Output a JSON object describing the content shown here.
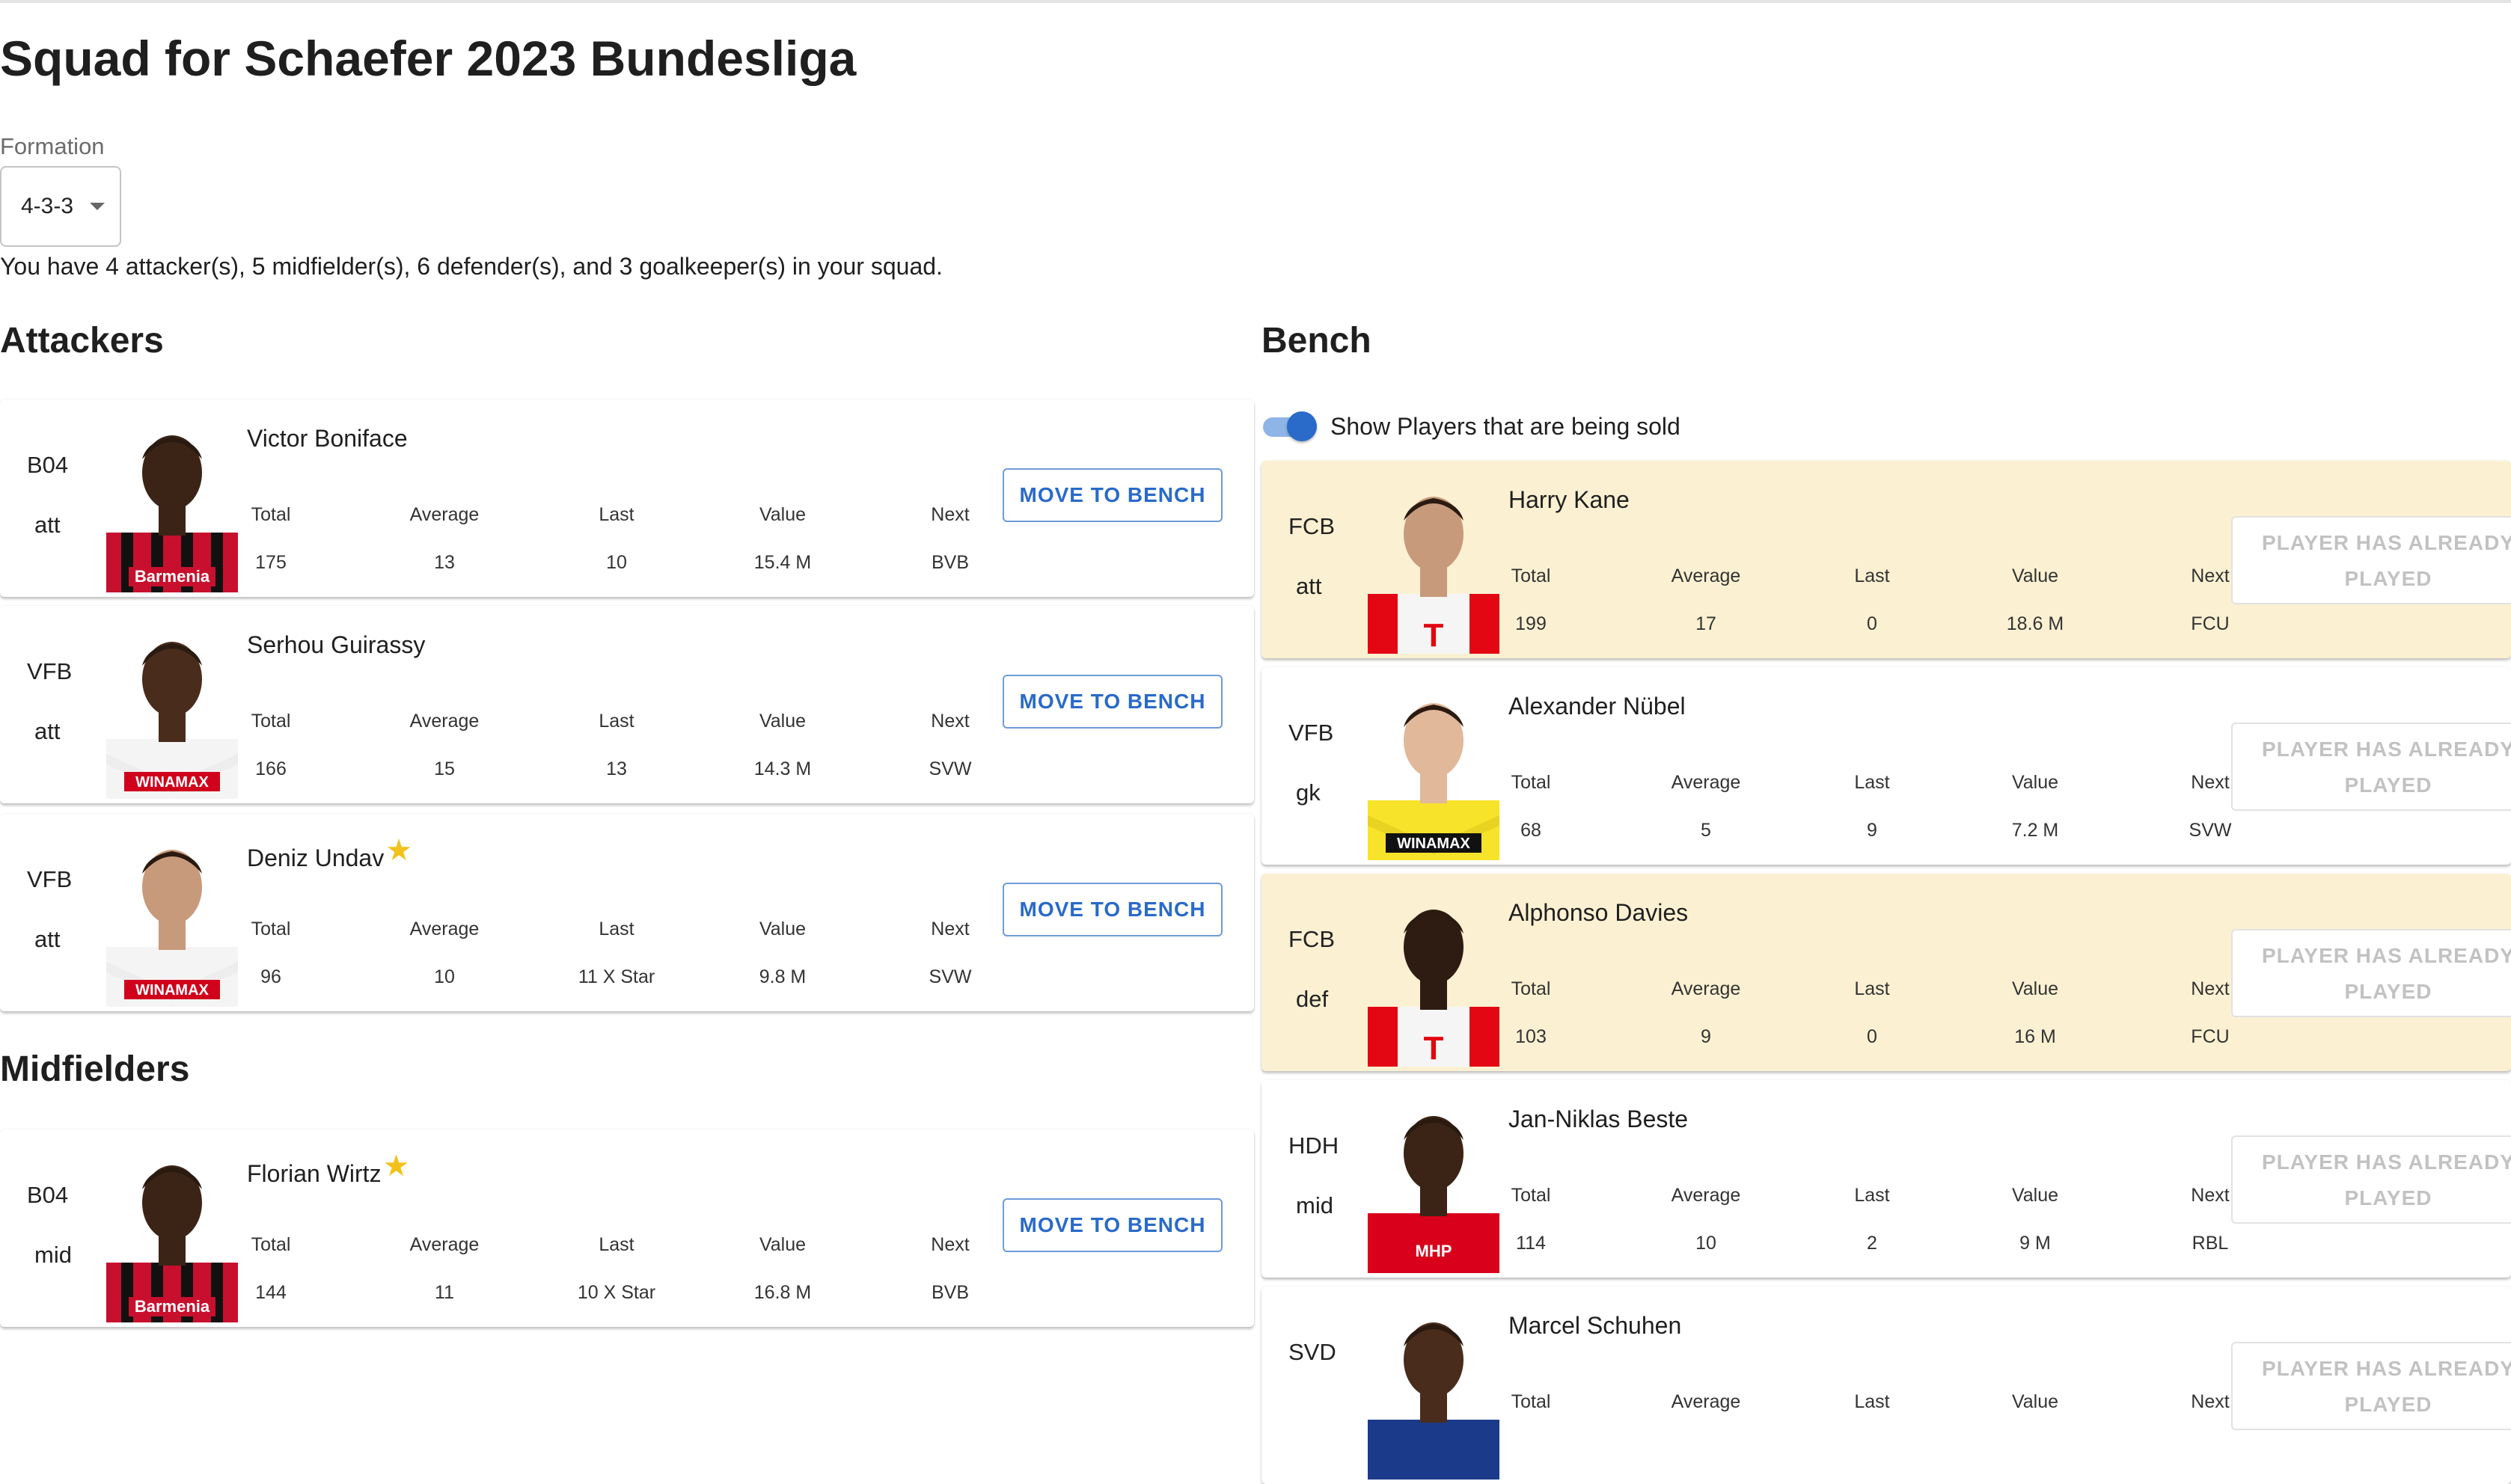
{
  "page": {
    "title": "Squad for Schaefer 2023 Bundesliga"
  },
  "formation": {
    "label": "Formation",
    "value": "4-3-3"
  },
  "summary": "You have 4 attacker(s), 5 midfielder(s), 6 defender(s), and 3 goalkeeper(s) in your squad.",
  "sections": {
    "attackers": "Attackers",
    "midfielders": "Midfielders",
    "bench": "Bench"
  },
  "stat_labels": {
    "total": "Total",
    "average": "Average",
    "last": "Last",
    "value": "Value",
    "next": "Next"
  },
  "buttons": {
    "move_to_bench": "MOVE TO BENCH",
    "already_played_1": "PLAYER HAS ALREADY",
    "already_played_2": "PLAYED"
  },
  "bench_toggle": {
    "label": "Show Players that are being sold",
    "on": true
  },
  "colors": {
    "accent": "#2a6ac9",
    "sold_highlight": "#fbf1d2",
    "star": "#f2c21b"
  },
  "attackers": [
    {
      "club": "B04",
      "pos": "att",
      "name": "Victor Boniface",
      "star": false,
      "total": "175",
      "average": "13",
      "last": "10",
      "value": "15.4 M",
      "next": "BVB"
    },
    {
      "club": "VFB",
      "pos": "att",
      "name": "Serhou Guirassy",
      "star": false,
      "total": "166",
      "average": "15",
      "last": "13",
      "value": "14.3 M",
      "next": "SVW"
    },
    {
      "club": "VFB",
      "pos": "att",
      "name": "Deniz Undav",
      "star": true,
      "total": "96",
      "average": "10",
      "last": "11 X Star",
      "value": "9.8 M",
      "next": "SVW"
    }
  ],
  "midfielders": [
    {
      "club": "B04",
      "pos": "mid",
      "name": "Florian Wirtz",
      "star": true,
      "total": "144",
      "average": "11",
      "last": "10 X Star",
      "value": "16.8 M",
      "next": "BVB"
    }
  ],
  "bench": [
    {
      "club": "FCB",
      "pos": "att",
      "name": "Harry Kane",
      "sold": true,
      "total": "199",
      "average": "17",
      "last": "0",
      "value": "18.6 M",
      "next": "FCU"
    },
    {
      "club": "VFB",
      "pos": "gk",
      "name": "Alexander Nübel",
      "sold": false,
      "total": "68",
      "average": "5",
      "last": "9",
      "value": "7.2 M",
      "next": "SVW"
    },
    {
      "club": "FCB",
      "pos": "def",
      "name": "Alphonso Davies",
      "sold": true,
      "total": "103",
      "average": "9",
      "last": "0",
      "value": "16 M",
      "next": "FCU"
    },
    {
      "club": "HDH",
      "pos": "mid",
      "name": "Jan-Niklas Beste",
      "sold": false,
      "total": "114",
      "average": "10",
      "last": "2",
      "value": "9 M",
      "next": "RBL"
    },
    {
      "club": "SVD",
      "pos": "",
      "name": "Marcel Schuhen",
      "sold": false,
      "total": "",
      "average": "",
      "last": "",
      "value": "",
      "next": ""
    }
  ]
}
